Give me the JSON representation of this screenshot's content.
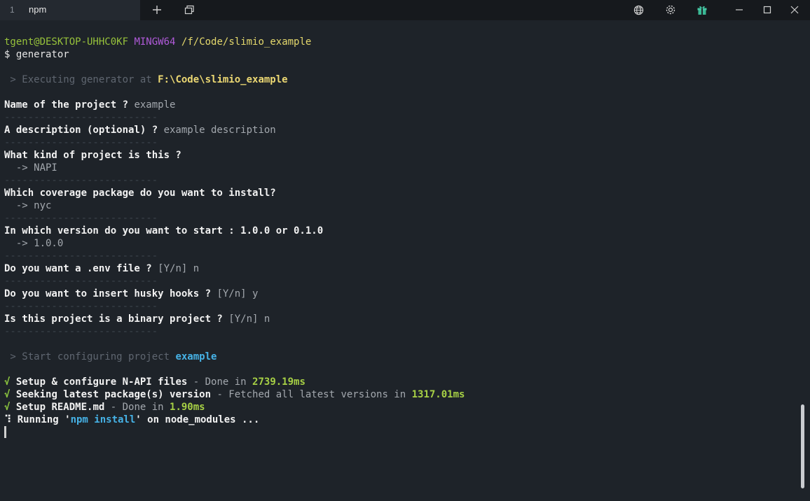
{
  "tab": {
    "index": "1",
    "title": "npm"
  },
  "tabbar": {
    "new_tab_icon": "plus-icon",
    "split_icon": "overlapping-windows-icon",
    "globe_icon": "globe-icon",
    "settings_icon": "gear-icon",
    "gift_icon": "gift-icon"
  },
  "prompt": {
    "user": "tgent@DESKTOP-UHHC0KF",
    "shell": "MINGW64",
    "path": "/f/Code/slimio_example",
    "command": "$ generator"
  },
  "exec": {
    "prefix": " > Executing generator at ",
    "path": "F:\\Code\\slimio_example"
  },
  "separator": "--------------------------",
  "questions": [
    {
      "q": "Name of the project ? ",
      "a": "example"
    },
    {
      "q": "A description (optional) ? ",
      "a": "example description"
    },
    {
      "q": "What kind of project is this ?",
      "a": "  -> NAPI"
    },
    {
      "q": "Which coverage package do you want to install?",
      "a": "  -> nyc"
    },
    {
      "q": "In which version do you want to start : 1.0.0 or 0.1.0",
      "a": "  -> 1.0.0"
    },
    {
      "q": "Do you want a .env file ? ",
      "a": "[Y/n] n"
    },
    {
      "q": "Do you want to insert husky hooks ? ",
      "a": "[Y/n] y"
    },
    {
      "q": "Is this project is a binary project ? ",
      "a": "[Y/n] n"
    }
  ],
  "configure": {
    "prefix": " > Start configuring project ",
    "name": "example"
  },
  "steps": [
    {
      "mark": "√",
      "label": " Setup & configure N-API files",
      "detail": " - Done in ",
      "time": "2739.19ms"
    },
    {
      "mark": "√",
      "label": " Seeking latest package(s) version",
      "detail": " - Fetched all latest versions in ",
      "time": "1317.01ms"
    },
    {
      "mark": "√",
      "label": " Setup README.md",
      "detail": " - Done in ",
      "time": "1.90ms"
    }
  ],
  "running": {
    "spinner": "⠹",
    "pre": " Running '",
    "cmd": "npm install",
    "post": "' on node_modules ..."
  },
  "colors": {
    "background": "#1e2329",
    "tabbar": "#16191d",
    "green": "#97c23b",
    "magenta": "#b05ad9",
    "yellow": "#e4d86c",
    "cyan": "#46b2e6"
  }
}
